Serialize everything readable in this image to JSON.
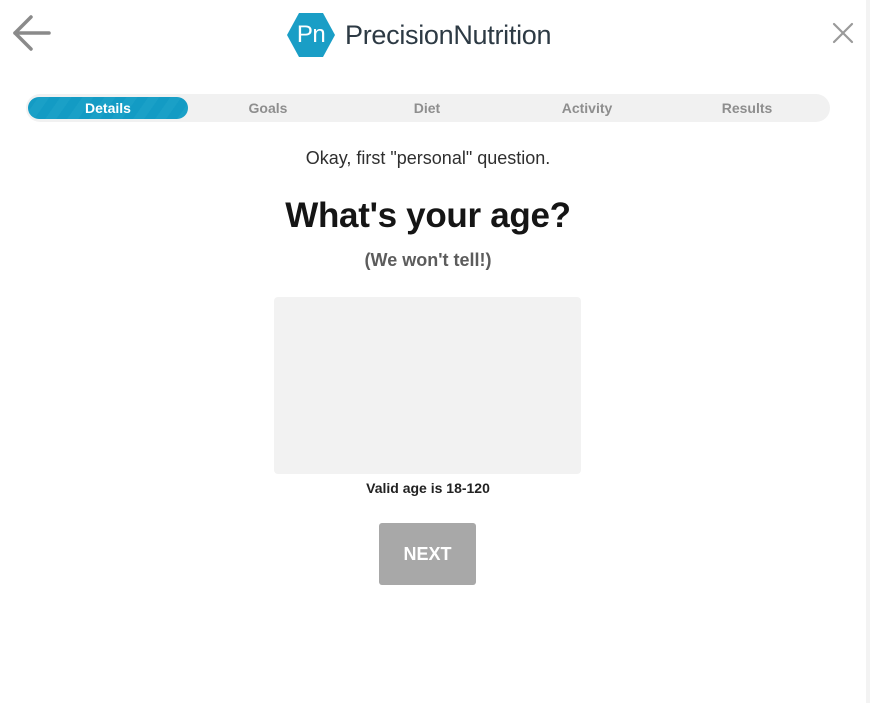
{
  "header": {
    "logo_mark": "Pn",
    "logo_word_1": "Precision",
    "logo_word_2": "Nutrition",
    "back_icon": "arrow-left-icon",
    "close_icon": "close-icon"
  },
  "progress": {
    "steps": [
      {
        "label": "Details",
        "active": true
      },
      {
        "label": "Goals",
        "active": false
      },
      {
        "label": "Diet",
        "active": false
      },
      {
        "label": "Activity",
        "active": false
      },
      {
        "label": "Results",
        "active": false
      }
    ]
  },
  "main": {
    "intro": "Okay, first \"personal\" question.",
    "question": "What's your age?",
    "subtext": "(We won't tell!)",
    "age_value": "",
    "hint": "Valid age is 18-120",
    "next_label": "NEXT"
  },
  "colors": {
    "brand": "#1a9ec6",
    "active_step": "#149bc4",
    "next_disabled": "#a8a8a8",
    "input_bg": "#f2f2f2"
  }
}
